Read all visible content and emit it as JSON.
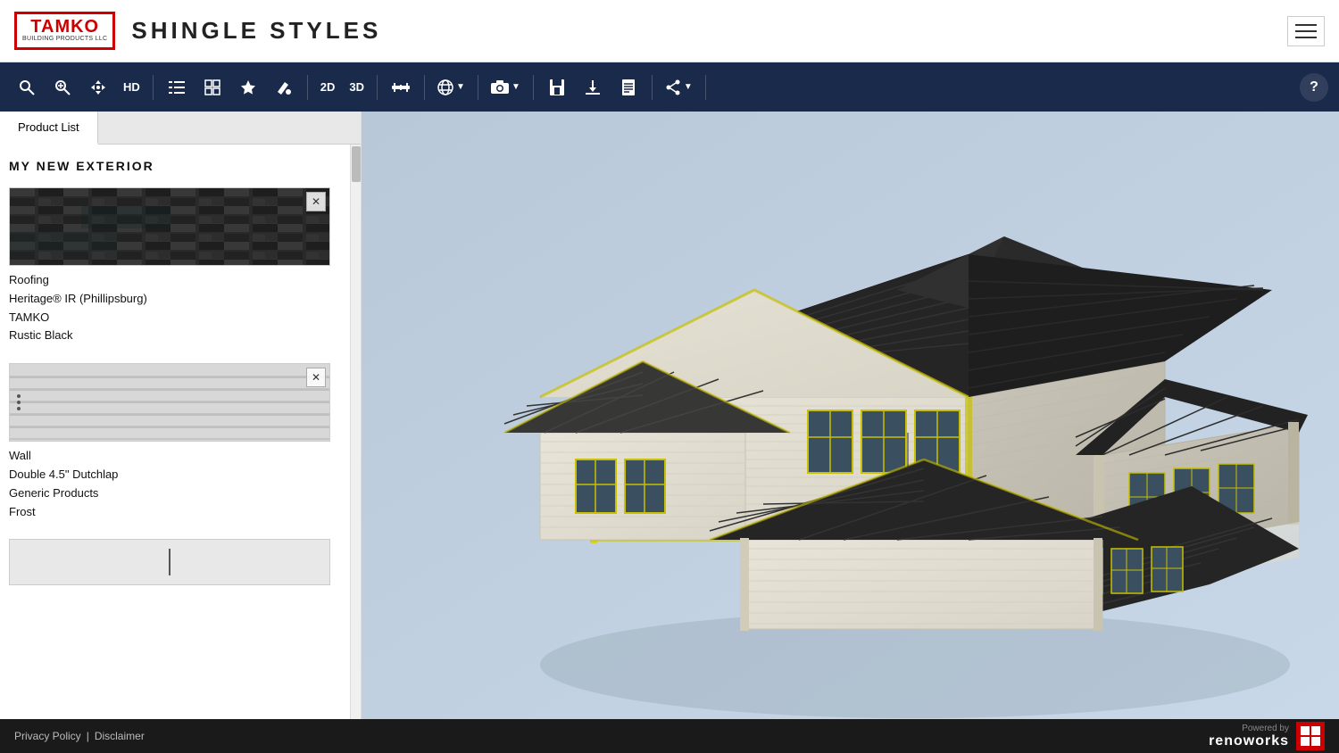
{
  "header": {
    "logo_brand": "TAMKO",
    "logo_sub1": "BUILDING PRODUCTS LLC",
    "app_title": "SHINGLE STYLES"
  },
  "toolbar": {
    "buttons": [
      {
        "id": "search",
        "icon": "🔍",
        "label": "Search"
      },
      {
        "id": "zoom-in",
        "icon": "🔎",
        "label": "Zoom In"
      },
      {
        "id": "move",
        "icon": "✛",
        "label": "Move"
      },
      {
        "id": "hd",
        "icon": "HD",
        "label": "HD Mode"
      },
      {
        "id": "list",
        "icon": "☰",
        "label": "List"
      },
      {
        "id": "compare",
        "icon": "⊡",
        "label": "Compare"
      },
      {
        "id": "favorite",
        "icon": "★",
        "label": "Favorite"
      },
      {
        "id": "paint",
        "icon": "◈",
        "label": "Paint"
      },
      {
        "id": "2d",
        "icon": "2D",
        "label": "2D View"
      },
      {
        "id": "3d",
        "icon": "3D",
        "label": "3D View"
      },
      {
        "id": "measure",
        "icon": "📏",
        "label": "Measure"
      },
      {
        "id": "globe",
        "icon": "🌐",
        "label": "Language",
        "dropdown": true
      },
      {
        "id": "camera",
        "icon": "📷",
        "label": "Camera",
        "dropdown": true
      },
      {
        "id": "save",
        "icon": "💾",
        "label": "Save"
      },
      {
        "id": "download",
        "icon": "⬇",
        "label": "Download"
      },
      {
        "id": "doc",
        "icon": "📄",
        "label": "Document"
      },
      {
        "id": "share",
        "icon": "↗",
        "label": "Share",
        "dropdown": true
      },
      {
        "id": "help",
        "icon": "?",
        "label": "Help"
      }
    ]
  },
  "sidebar": {
    "tabs": [
      {
        "id": "product-list",
        "label": "Product List",
        "active": true
      }
    ],
    "section_title": "MY NEW EXTERIOR",
    "products": [
      {
        "id": "roofing",
        "type": "Roofing",
        "name": "Heritage® IR (Phillipsburg)",
        "brand": "TAMKO",
        "color": "Rustic Black",
        "img_type": "roofing"
      },
      {
        "id": "wall",
        "type": "Wall",
        "name": "Double 4.5\" Dutchlap",
        "brand": "Generic Products",
        "color": "Frost",
        "img_type": "wall"
      },
      {
        "id": "partial",
        "type": "",
        "name": "",
        "brand": "",
        "color": "",
        "img_type": "partial"
      }
    ]
  },
  "footer": {
    "privacy_policy": "Privacy Policy",
    "separator": "|",
    "disclaimer": "Disclaimer",
    "powered_by": "Powered by",
    "brand": "renoworks"
  },
  "viewport": {
    "mode": "3D"
  }
}
